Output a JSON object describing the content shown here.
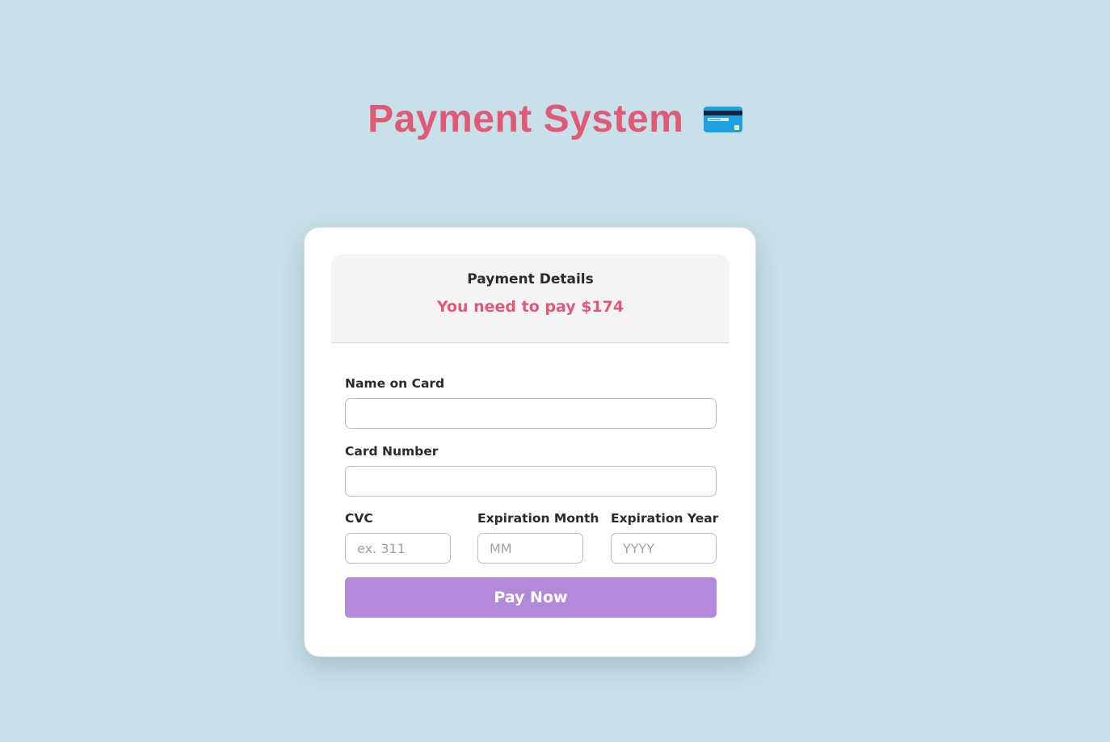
{
  "page": {
    "title": "Payment System",
    "icon": "credit-card-icon",
    "background_color": "#c8e0e7",
    "accent_color": "#e05a78",
    "button_color": "#b38ad9"
  },
  "payment": {
    "header_title": "Payment Details",
    "amount_text": "You need to pay $174"
  },
  "form": {
    "name_label": "Name on Card",
    "name_value": "",
    "card_number_label": "Card Number",
    "card_number_value": "",
    "cvc_label": "CVC",
    "cvc_placeholder": "ex. 311",
    "exp_month_label": "Expiration Month",
    "exp_month_placeholder": "MM",
    "exp_year_label": "Expiration Year",
    "exp_year_placeholder": "YYYY",
    "submit_label": "Pay Now"
  }
}
